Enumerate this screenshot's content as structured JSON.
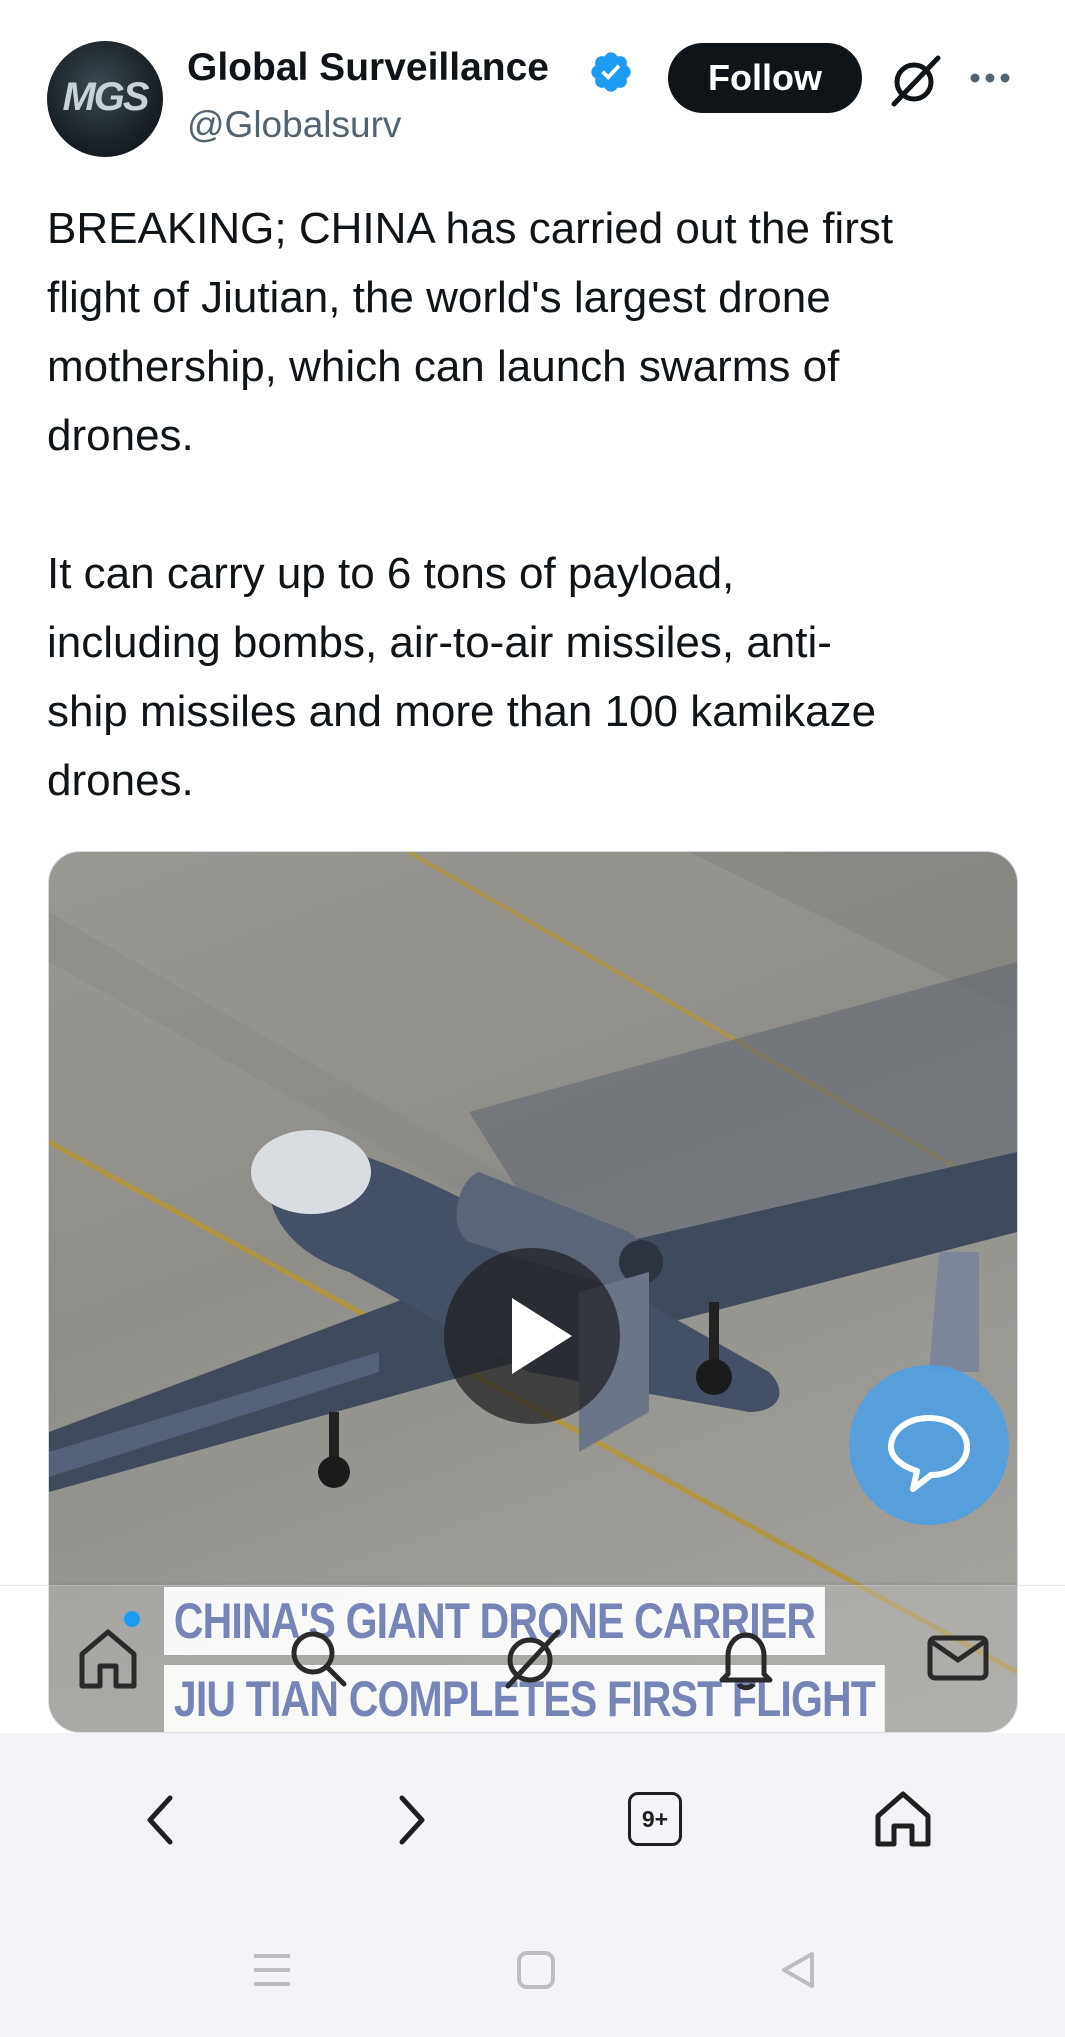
{
  "author": {
    "avatar_text": "MGS",
    "display_name": "Global Surveillance",
    "handle": "@Globalsurv",
    "verified": true
  },
  "header": {
    "follow_label": "Follow",
    "grok_icon": "grok-icon",
    "more_icon": "more-icon"
  },
  "tweet": {
    "text": "BREAKING; CHINA has carried out the first\nflight of Jiutian, the world's largest drone\nmothership, which can launch swarms of\ndrones.\n\nIt can carry up to 6 tons of payload,\nincluding bombs, air-to-air missiles, anti-\nship missiles and more than 100 kamikaze\ndrones."
  },
  "media": {
    "type": "video",
    "caption_line1": "CHINA'S GIANT DRONE CARRIER",
    "caption_line2": "JIU TIAN COMPLETES FIRST FLIGHT",
    "play_icon": "play-icon",
    "colors": {
      "caption_text": "#5a6aa8",
      "drone": "#3f4a5d"
    }
  },
  "fab": {
    "icon": "chat-bubble-icon",
    "color": "#4aa0e6"
  },
  "tab_bar": {
    "items": [
      "home-icon",
      "search-icon",
      "grok-icon",
      "notifications-icon",
      "messages-icon"
    ],
    "home_badge": true
  },
  "browser": {
    "back_icon": "chevron-left-icon",
    "forward_icon": "chevron-right-icon",
    "tab_count": "9+",
    "home_icon": "home-icon"
  },
  "system_nav": [
    "recents-icon",
    "home-square-icon",
    "back-triangle-icon"
  ],
  "colors": {
    "accent": "#1d9bf0",
    "text": "#0f1419",
    "secondary": "#536471"
  }
}
